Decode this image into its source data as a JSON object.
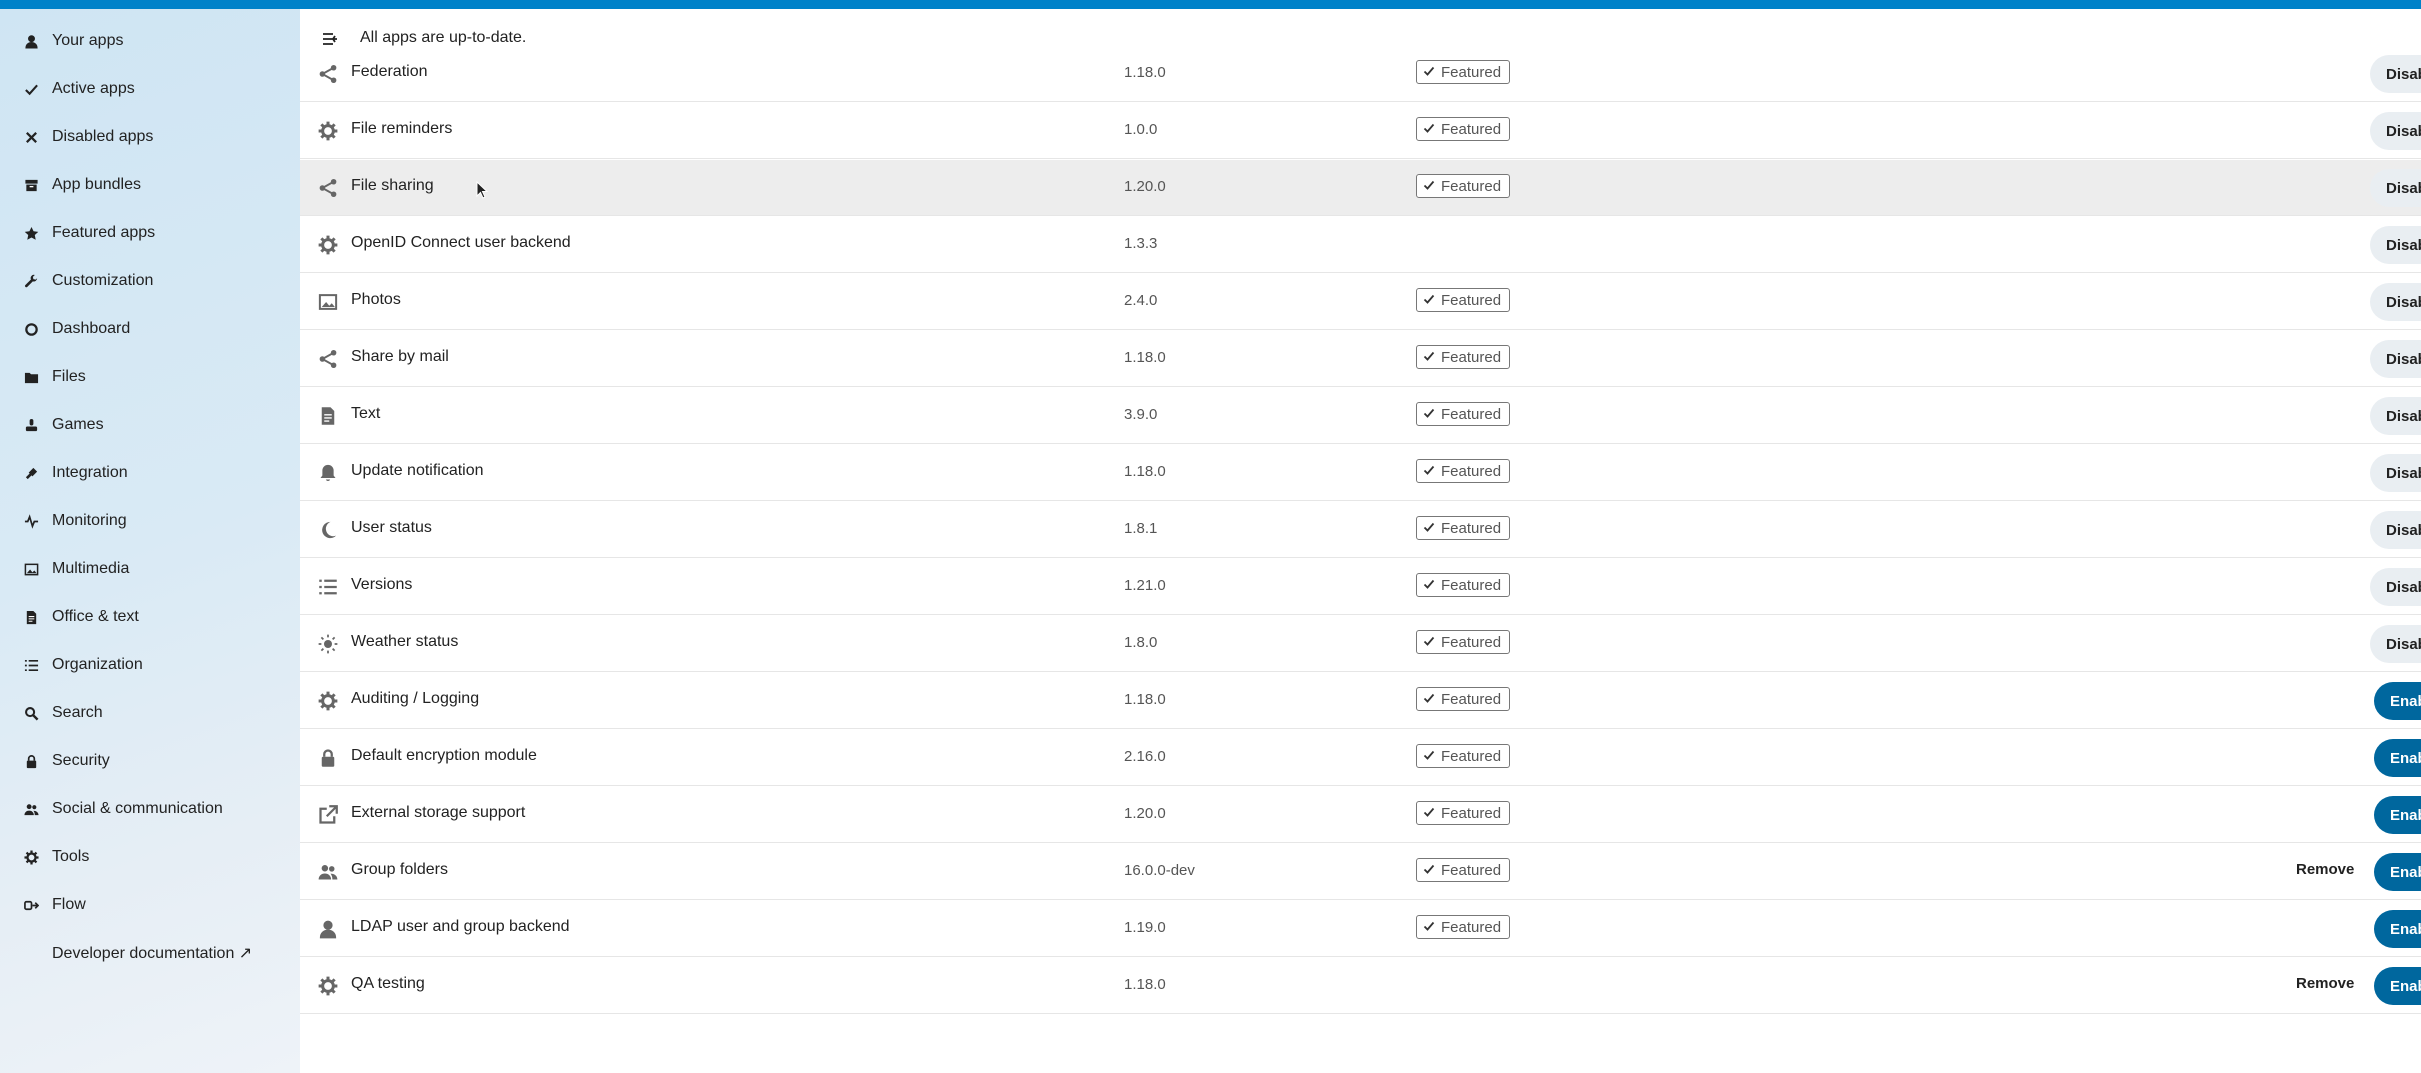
{
  "sidebar": {
    "items": [
      {
        "label": "Your apps",
        "icon": "user-icon"
      },
      {
        "label": "Active apps",
        "icon": "check-icon"
      },
      {
        "label": "Disabled apps",
        "icon": "close-icon"
      },
      {
        "label": "App bundles",
        "icon": "archive-icon"
      },
      {
        "label": "Featured apps",
        "icon": "star-icon"
      },
      {
        "label": "Customization",
        "icon": "wrench-icon"
      },
      {
        "label": "Dashboard",
        "icon": "circle-icon"
      },
      {
        "label": "Files",
        "icon": "folder-icon"
      },
      {
        "label": "Games",
        "icon": "gamepad-icon"
      },
      {
        "label": "Integration",
        "icon": "plug-icon"
      },
      {
        "label": "Monitoring",
        "icon": "pulse-icon"
      },
      {
        "label": "Multimedia",
        "icon": "image-icon"
      },
      {
        "label": "Office & text",
        "icon": "document-icon"
      },
      {
        "label": "Organization",
        "icon": "list-icon"
      },
      {
        "label": "Search",
        "icon": "search-icon"
      },
      {
        "label": "Security",
        "icon": "lock-icon"
      },
      {
        "label": "Social & communication",
        "icon": "contacts-icon"
      },
      {
        "label": "Tools",
        "icon": "gear-icon"
      },
      {
        "label": "Flow",
        "icon": "flow-icon"
      },
      {
        "label": "Developer documentation ↗",
        "icon": ""
      }
    ]
  },
  "header": {
    "status": "All apps are up-to-date."
  },
  "apps": [
    {
      "name": "Federation",
      "version": "1.18.0",
      "featured": "Featured",
      "action": "Disable",
      "icon": "share-icon"
    },
    {
      "name": "File reminders",
      "version": "1.0.0",
      "featured": "Featured",
      "action": "Disable",
      "icon": "gear-icon"
    },
    {
      "name": "File sharing",
      "version": "1.20.0",
      "featured": "Featured",
      "action": "Disable",
      "icon": "share-icon"
    },
    {
      "name": "OpenID Connect user backend",
      "version": "1.3.3",
      "featured": "",
      "action": "Disable",
      "icon": "gear-icon"
    },
    {
      "name": "Photos",
      "version": "2.4.0",
      "featured": "Featured",
      "action": "Disable",
      "icon": "image-icon"
    },
    {
      "name": "Share by mail",
      "version": "1.18.0",
      "featured": "Featured",
      "action": "Disable",
      "icon": "share-icon"
    },
    {
      "name": "Text",
      "version": "3.9.0",
      "featured": "Featured",
      "action": "Disable",
      "icon": "document-icon"
    },
    {
      "name": "Update notification",
      "version": "1.18.0",
      "featured": "Featured",
      "action": "Disable",
      "icon": "bell-icon"
    },
    {
      "name": "User status",
      "version": "1.8.1",
      "featured": "Featured",
      "action": "Disable",
      "icon": "moon-icon"
    },
    {
      "name": "Versions",
      "version": "1.21.0",
      "featured": "Featured",
      "action": "Disable",
      "icon": "list-icon"
    },
    {
      "name": "Weather status",
      "version": "1.8.0",
      "featured": "Featured",
      "action": "Disable",
      "icon": "sun-icon"
    },
    {
      "name": "Auditing / Logging",
      "version": "1.18.0",
      "featured": "Featured",
      "action": "Enable",
      "icon": "gear-icon"
    },
    {
      "name": "Default encryption module",
      "version": "2.16.0",
      "featured": "Featured",
      "action": "Enable",
      "icon": "lock-icon"
    },
    {
      "name": "External storage support",
      "version": "1.20.0",
      "featured": "Featured",
      "action": "Enable",
      "icon": "external-link-icon"
    },
    {
      "name": "Group folders",
      "version": "16.0.0-dev",
      "featured": "Featured",
      "action": "Enable",
      "remove": "Remove",
      "icon": "group-icon"
    },
    {
      "name": "LDAP user and group backend",
      "version": "1.19.0",
      "featured": "Featured",
      "action": "Enable",
      "icon": "user-icon"
    },
    {
      "name": "QA testing",
      "version": "1.18.0",
      "featured": "",
      "action": "Enable",
      "remove": "Remove",
      "icon": "gear-icon"
    }
  ],
  "colors": {
    "accent": "#0082c9",
    "enable_button": "#00679e",
    "disable_button": "#e9eef2"
  }
}
